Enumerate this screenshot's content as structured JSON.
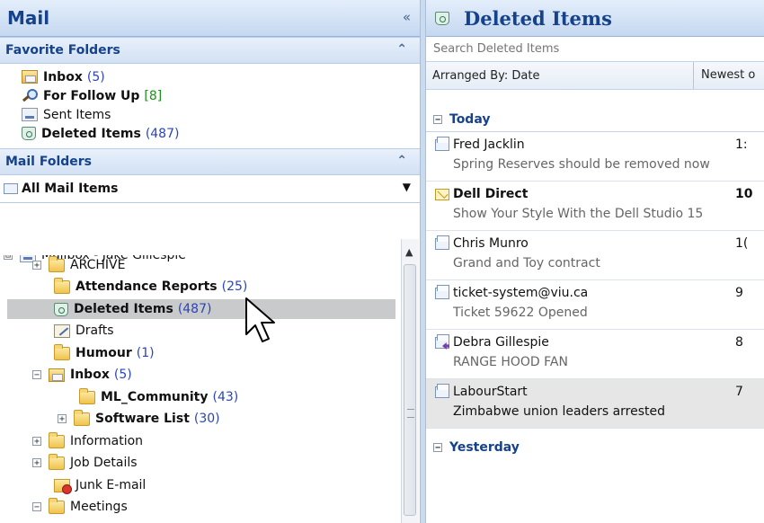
{
  "nav": {
    "title": "Mail",
    "collapse_glyph": "«",
    "favorites": {
      "header": "Favorite Folders",
      "chevron": "⌃",
      "items": [
        {
          "label": "Inbox",
          "count": "(5)",
          "icon": "inbox-icon",
          "bold": true,
          "count_color": "blue"
        },
        {
          "label": "For Follow Up",
          "count": "[8]",
          "icon": "search-folder-icon",
          "bold": true,
          "count_color": "green"
        },
        {
          "label": "Sent Items",
          "count": "",
          "icon": "sent-items-icon",
          "bold": false
        },
        {
          "label": "Deleted Items",
          "count": "(487)",
          "icon": "deleted-items-icon",
          "bold": true,
          "count_color": "blue"
        }
      ]
    },
    "mail_folders": {
      "header": "Mail Folders",
      "chevron": "⌃",
      "selector": "All Mail Items",
      "dropdown_glyph": "▼",
      "tree": [
        {
          "label": "Mailbox - Jake Gillespie",
          "count": "",
          "depth": 0,
          "expander": "⊟",
          "icon": "mailbox-icon",
          "bold": false,
          "partial": true
        },
        {
          "label": "ARCHIVE",
          "count": "",
          "depth": 1,
          "expander": "+",
          "icon": "folder-icon",
          "bold": false
        },
        {
          "label": "Attendance Reports",
          "count": "(25)",
          "depth": 1,
          "expander": "",
          "icon": "folder-icon",
          "bold": true
        },
        {
          "label": "Deleted Items",
          "count": "(487)",
          "depth": 1,
          "expander": "",
          "icon": "deleted-items-icon",
          "bold": true,
          "selected": true
        },
        {
          "label": "Drafts",
          "count": "",
          "depth": 1,
          "expander": "",
          "icon": "drafts-icon",
          "bold": false
        },
        {
          "label": "Humour",
          "count": "(1)",
          "depth": 1,
          "expander": "",
          "icon": "folder-icon",
          "bold": true
        },
        {
          "label": "Inbox",
          "count": "(5)",
          "depth": 1,
          "expander": "−",
          "icon": "inbox-icon",
          "bold": true
        },
        {
          "label": "ML_Community",
          "count": "(43)",
          "depth": 2,
          "expander": "",
          "icon": "folder-icon",
          "bold": true
        },
        {
          "label": "Software List",
          "count": "(30)",
          "depth": 2,
          "expander": "+",
          "icon": "folder-icon",
          "bold": true
        },
        {
          "label": "Information",
          "count": "",
          "depth": 1,
          "expander": "+",
          "icon": "folder-icon",
          "bold": false
        },
        {
          "label": "Job Details",
          "count": "",
          "depth": 1,
          "expander": "+",
          "icon": "folder-icon",
          "bold": false
        },
        {
          "label": "Junk E-mail",
          "count": "",
          "depth": 1,
          "expander": "",
          "icon": "junk-email-icon",
          "bold": false
        },
        {
          "label": "Meetings",
          "count": "",
          "depth": 1,
          "expander": "−",
          "icon": "folder-icon",
          "bold": false,
          "partial": true
        }
      ]
    }
  },
  "list": {
    "title": "Deleted Items",
    "search_placeholder": "Search Deleted Items",
    "arranged_by": "Arranged By: Date",
    "order": "Newest o",
    "groups": [
      {
        "label": "Today",
        "expander": "−",
        "messages": [
          {
            "sender": "Fred Jacklin",
            "time": "1:",
            "subject": "Spring Reserves should be removed now",
            "state": "read"
          },
          {
            "sender": "Dell Direct",
            "time": "10",
            "subject": "Show Your Style With the Dell Studio 15",
            "state": "unread"
          },
          {
            "sender": "Chris Munro",
            "time": "1(",
            "subject": "Grand and Toy contract",
            "state": "read"
          },
          {
            "sender": "ticket-system@viu.ca",
            "time": "9",
            "subject": "Ticket 59622 Opened",
            "state": "read"
          },
          {
            "sender": "Debra Gillespie",
            "time": "8",
            "subject": "RANGE HOOD FAN",
            "state": "replied"
          },
          {
            "sender": "LabourStart",
            "time": "7",
            "subject": "Zimbabwe union leaders arrested",
            "state": "read",
            "selected": true
          }
        ]
      },
      {
        "label": "Yesterday",
        "expander": "−",
        "messages": []
      }
    ]
  },
  "colors": {
    "header_text": "#15428b",
    "count_blue": "#2b45b7",
    "count_green": "#1d8f1d",
    "selection": "#c9cacb"
  }
}
